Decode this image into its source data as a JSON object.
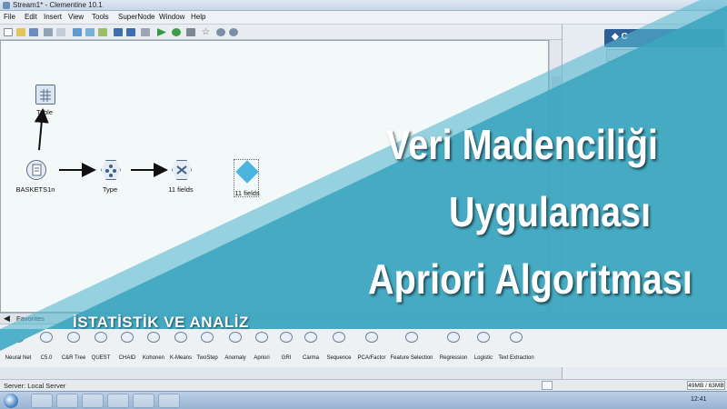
{
  "window": {
    "title": "Stream1* - Clementine 10.1"
  },
  "menu": [
    "File",
    "Edit",
    "Insert",
    "View",
    "Tools",
    "SuperNode",
    "Window",
    "Help"
  ],
  "canvas": {
    "nodes": {
      "table": "Table",
      "source": "BASKETS1n",
      "type": "Type",
      "filter": "11 fields",
      "apriori": "11 fields"
    }
  },
  "palette": {
    "tab": "Favorites",
    "items": [
      "Neural Net",
      "C5.0",
      "C&R Tree",
      "QUEST",
      "CHAID",
      "Kohonen",
      "K-Means",
      "TwoStep",
      "Anomaly",
      "Apriori",
      "GRI",
      "Carma",
      "Sequence",
      "PCA/Factor",
      "Feature Selection",
      "Regression",
      "Logistic",
      "Text Extraction"
    ]
  },
  "status": {
    "server": "Server: Local Server",
    "memory": "49MB / 63MB"
  },
  "taskbar": {
    "clock": "12:41"
  },
  "banner": {
    "line1": "Veri Madenciliği",
    "line2": "Uygulaması",
    "line3": "Apriori Algoritması",
    "subtitle": "İSTATİSTİK VE ANALİZ"
  },
  "colors": {
    "banner": "#3ea7c0",
    "accent": "#2d5f94"
  }
}
